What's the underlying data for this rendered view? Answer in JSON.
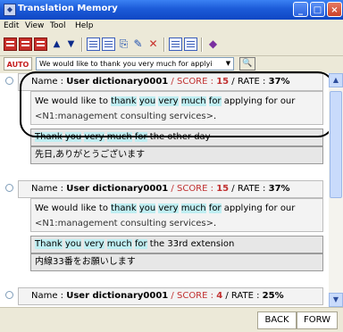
{
  "window": {
    "title": "Translation Memory"
  },
  "menu": [
    "Edit",
    "View",
    "Tool",
    "Help"
  ],
  "toolbar": {
    "auto_label": "AUTO",
    "search_value": "We would like to thank you very much for applyi"
  },
  "entries": [
    {
      "name_label": "Name : ",
      "name": "User dictionary0001",
      "sep": " / ",
      "score_label": "SCORE : ",
      "score": "15",
      "rate_label": " / RATE : ",
      "rate": "37%",
      "src": [
        "We would like to ",
        "thank",
        " ",
        "you",
        " ",
        "very",
        " ",
        "much",
        " ",
        "for",
        " applying for our ",
        "<N1:management consulting services>",
        "."
      ],
      "mt": [
        "Thank",
        " ",
        "you",
        " ",
        "very",
        " ",
        "much",
        " ",
        "for",
        " the other day"
      ],
      "jp": "先日,ありがとうございます"
    },
    {
      "name_label": "Name : ",
      "name": "User dictionary0001",
      "sep": " / ",
      "score_label": "SCORE : ",
      "score": "15",
      "rate_label": " / RATE : ",
      "rate": "37%",
      "src": [
        "We would like to ",
        "thank",
        " ",
        "you",
        " ",
        "very",
        " ",
        "much",
        " ",
        "for",
        " applying for our ",
        "<N1:management consulting services>",
        "."
      ],
      "mt": [
        "Thank",
        " ",
        "you",
        " ",
        "very",
        " ",
        "much",
        " ",
        "for",
        " the 33rd extension"
      ],
      "jp": "内線33番をお願いします"
    },
    {
      "name_label": "Name : ",
      "name": "User dictionary0001",
      "sep": " / ",
      "score_label": "SCORE : ",
      "score": "4",
      "rate_label": " / RATE : ",
      "rate": "25%"
    }
  ],
  "status": {
    "back": "BACK",
    "forw": "FORW"
  },
  "colors": {
    "titlebar": "#0f47c4",
    "highlight": "#bfeef2",
    "score": "#c03030",
    "auto": "#c62020"
  }
}
